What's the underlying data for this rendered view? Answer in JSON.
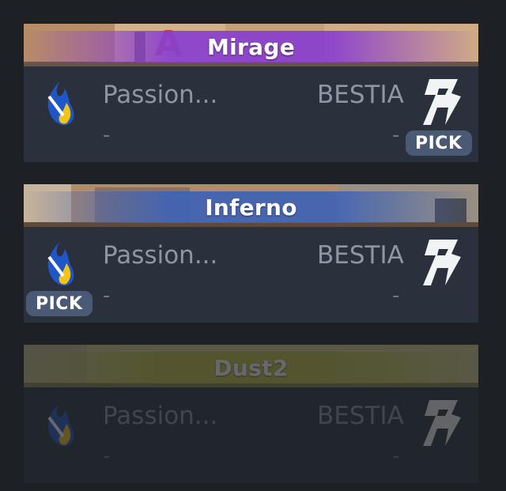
{
  "maps": [
    {
      "name": "Mirage",
      "strip_color": "#8a3fd0",
      "banner_tint": "#c9a57c",
      "team_left": {
        "name": "Passion...",
        "score": "-"
      },
      "team_right": {
        "name": "BESTIA",
        "score": "-"
      },
      "pick_label": "PICK",
      "picked_by": "right",
      "faded": false
    },
    {
      "name": "Inferno",
      "strip_color": "#3f63b6",
      "banner_tint": "#b08c6a",
      "team_left": {
        "name": "Passion...",
        "score": "-"
      },
      "team_right": {
        "name": "BESTIA",
        "score": "-"
      },
      "pick_label": "PICK",
      "picked_by": "left",
      "faded": false
    },
    {
      "name": "Dust2",
      "strip_color": "#c6c443",
      "banner_tint": "#d7d08a",
      "team_left": {
        "name": "Passion...",
        "score": "-"
      },
      "team_right": {
        "name": "BESTIA",
        "score": "-"
      },
      "pick_label": "",
      "picked_by": "none",
      "faded": true
    }
  ],
  "icons": {
    "left_team_logo": "passion-flame-logo",
    "right_team_logo": "bestia-b-logo"
  },
  "colors": {
    "background": "#1d2025",
    "card": "#2a313c",
    "pick_badge": "#4a5a75"
  }
}
